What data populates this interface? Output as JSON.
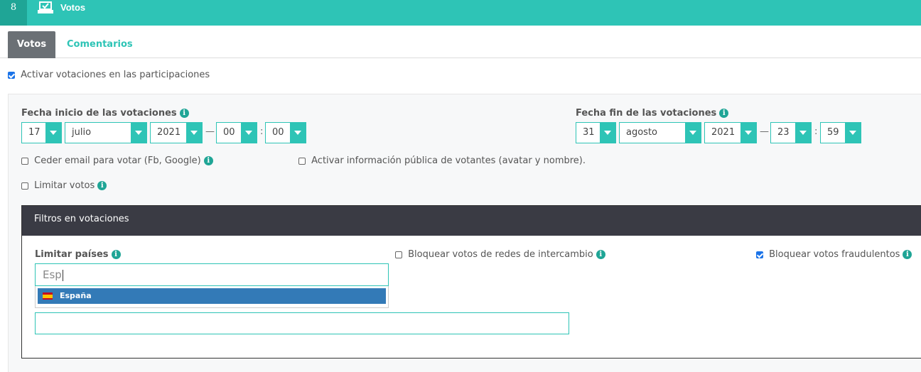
{
  "topbar": {
    "step": "8",
    "icon": "ballot-box-icon",
    "title": "Votos"
  },
  "tabs": [
    {
      "label": "Votos",
      "active": true
    },
    {
      "label": "Comentarios",
      "active": false
    }
  ],
  "activar": {
    "label": "Activar votaciones en las participaciones",
    "checked": true
  },
  "fecha_inicio": {
    "label": "Fecha inicio de las votaciones",
    "day": "17",
    "month": "julio",
    "year": "2021",
    "hour": "00",
    "minute": "00"
  },
  "fecha_fin": {
    "label": "Fecha fin de las votaciones",
    "day": "31",
    "month": "agosto",
    "year": "2021",
    "hour": "23",
    "minute": "59"
  },
  "separators": {
    "dash": "—",
    "colon": ":"
  },
  "options": {
    "ceder_email": {
      "label": "Ceder email para votar (Fb, Google)",
      "checked": false
    },
    "info_publica": {
      "label": "Activar información pública de votantes (avatar y nombre).",
      "checked": false
    },
    "limitar_votos": {
      "label": "Limitar votos",
      "checked": false
    }
  },
  "filtros": {
    "title": "Filtros en votaciones",
    "limitar_paises": {
      "label": "Limitar países",
      "search_value": "Esp",
      "suggestion": "España",
      "suggestion_icon": "spain-flag-icon"
    },
    "bloquear_intercambio": {
      "label": "Bloquear votos de redes de intercambio",
      "checked": false
    },
    "bloquear_fraudulentos": {
      "label": "Bloquear votos fraudulentos",
      "checked": true
    }
  },
  "colors": {
    "accent": "#2ec4b6",
    "tab_active": "#6b7075",
    "filters_header": "#3a3b44",
    "selection": "#337ab7"
  }
}
